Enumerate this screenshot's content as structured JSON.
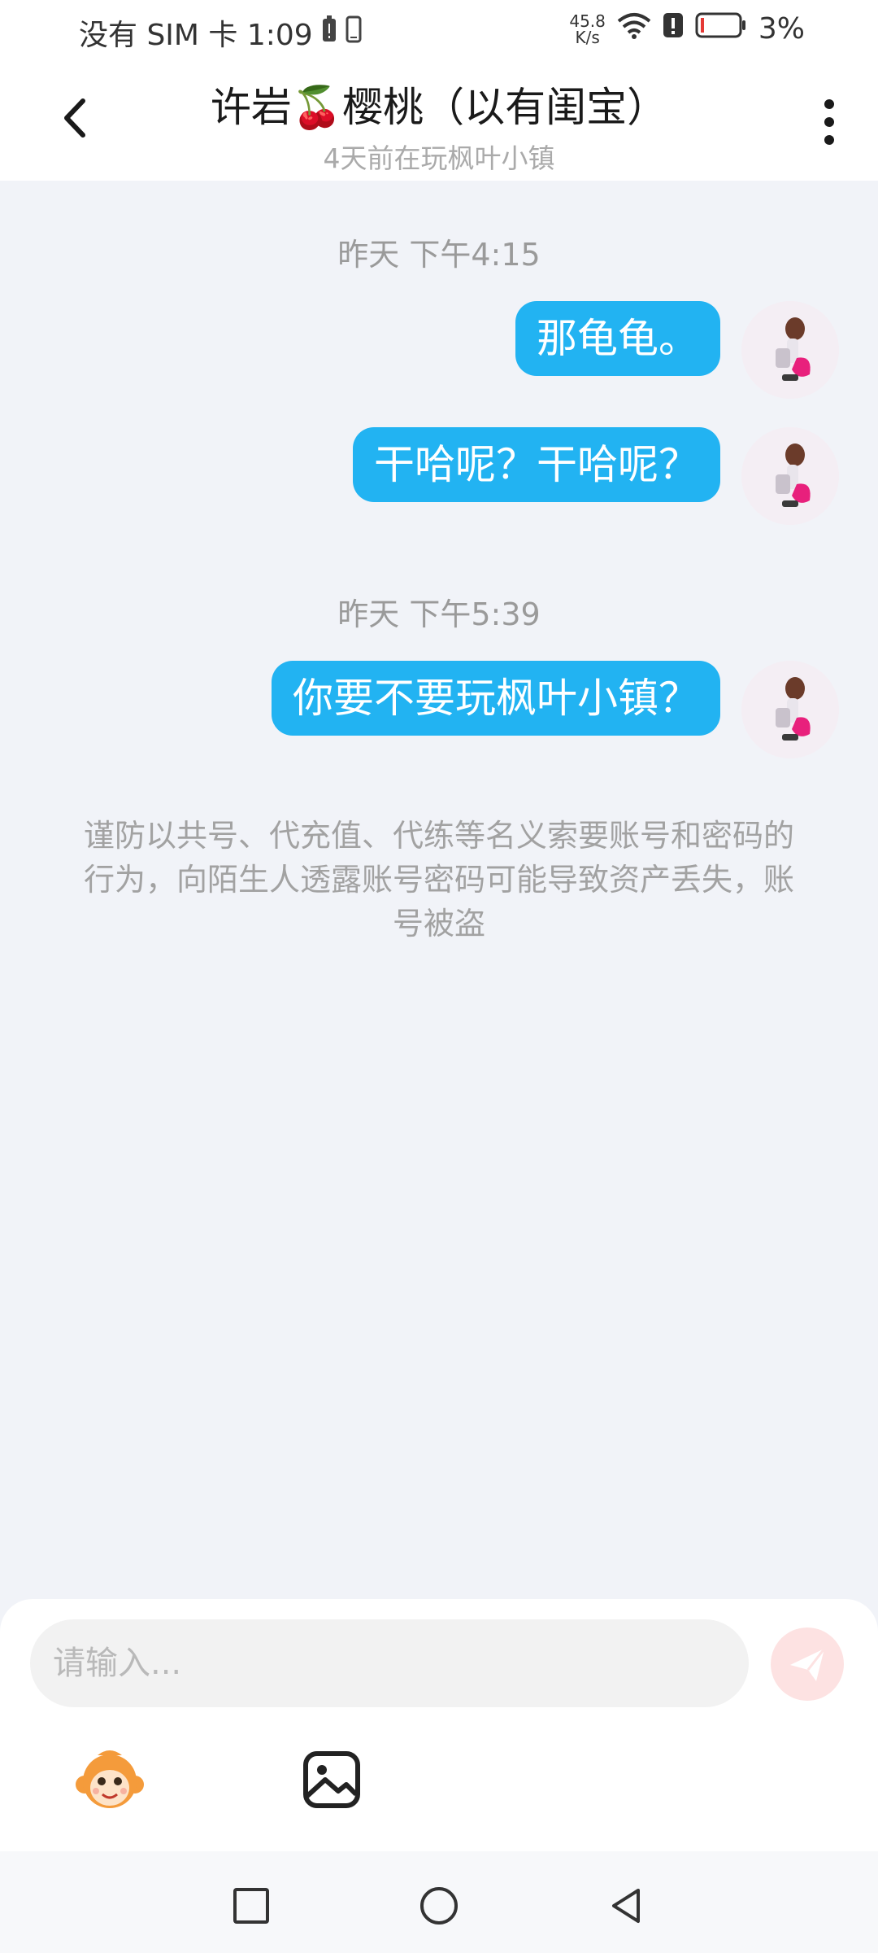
{
  "status_bar": {
    "carrier_time": "没有 SIM 卡 1:09",
    "speed_value": "45.8",
    "speed_unit": "K/s",
    "battery": "3%"
  },
  "header": {
    "title": "许岩🍒樱桃（以有闺宝）",
    "subtitle": "4天前在玩枫叶小镇"
  },
  "chat": {
    "groups": [
      {
        "timestamp": "昨天 下午4:15",
        "messages": [
          "那龟龟。",
          "干哈呢？干哈呢？"
        ]
      },
      {
        "timestamp": "昨天 下午5:39",
        "messages": [
          "你要不要玩枫叶小镇？"
        ]
      }
    ],
    "notice": "谨防以共号、代充值、代练等名义索要账号和密码的行为，向陌生人透露账号密码可能导致资产丢失，账号被盗"
  },
  "composer": {
    "placeholder": "请输入..."
  },
  "colors": {
    "bubble": "#22b3f2",
    "page_background": "#f1f3f8",
    "send_button": "#fde2e2"
  }
}
